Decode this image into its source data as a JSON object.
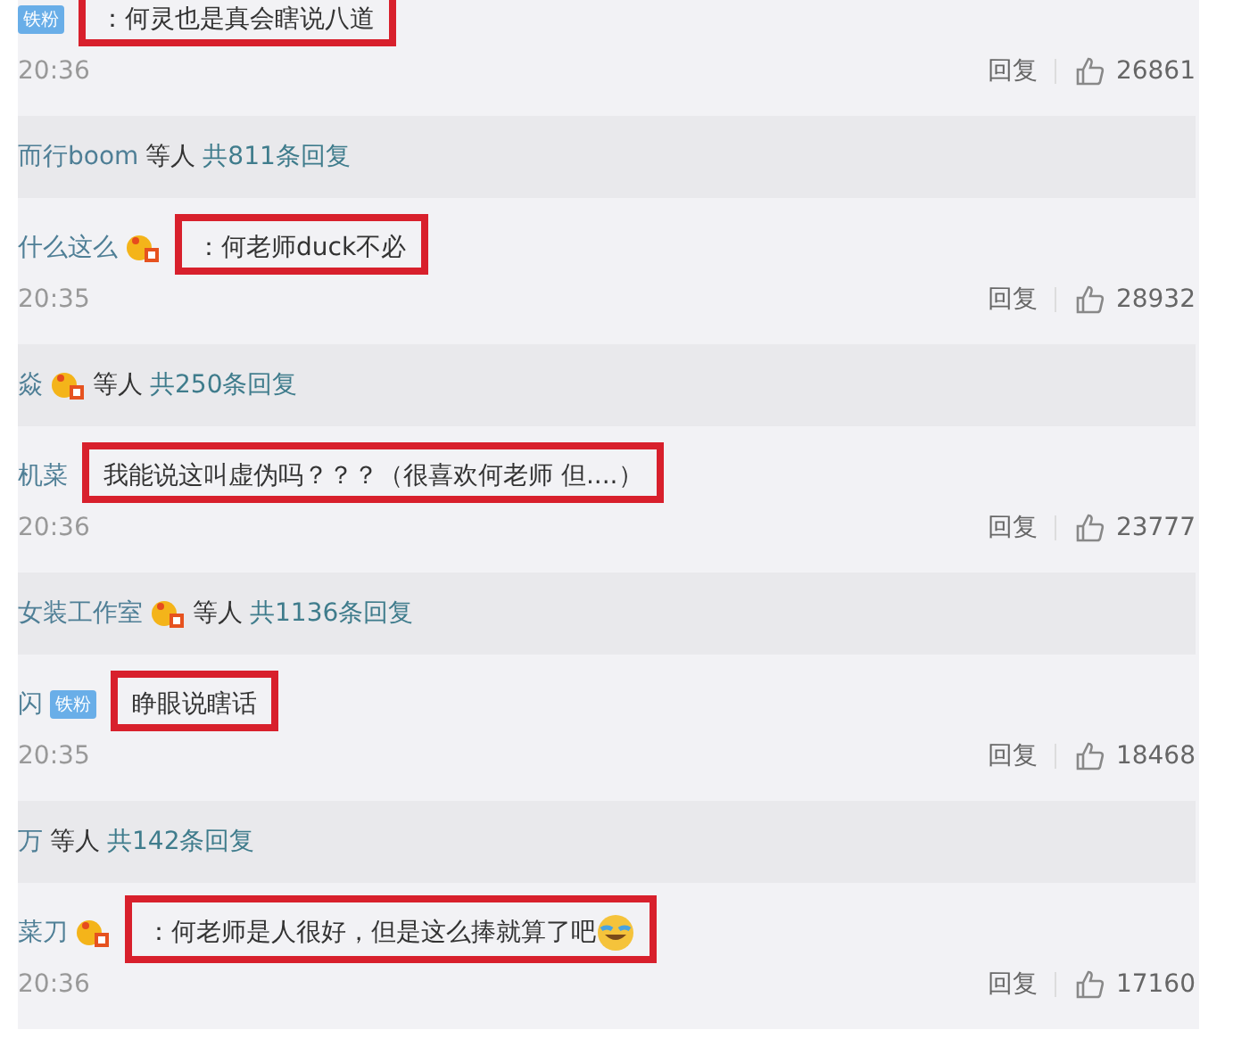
{
  "items": [
    {
      "kind": "comment",
      "badge": "铁粉",
      "vip": false,
      "text": "：何灵也是真会瞎说八道",
      "emoji": false,
      "highlighted": true,
      "time": "20:36",
      "reply": "回复",
      "likes": "26861"
    },
    {
      "kind": "summary",
      "names": "而行boom",
      "vip": false,
      "others": "等人",
      "count": "共811条回复"
    },
    {
      "kind": "comment",
      "name": "什么这么",
      "vip": true,
      "text": "：何老师duck不必",
      "emoji": false,
      "highlighted": true,
      "time": "20:35",
      "reply": "回复",
      "likes": "28932"
    },
    {
      "kind": "summary",
      "names": "焱",
      "vip": true,
      "others": "等人",
      "count": "共250条回复"
    },
    {
      "kind": "comment",
      "name": "机菜",
      "vip": false,
      "text": "我能说这叫虚伪吗？？？（很喜欢何老师 但....）",
      "emoji": false,
      "highlighted": true,
      "time": "20:36",
      "reply": "回复",
      "likes": "23777"
    },
    {
      "kind": "summary",
      "names": "女装工作室",
      "vip": true,
      "others": "等人",
      "count": "共1136条回复"
    },
    {
      "kind": "comment",
      "name": "闪",
      "badge": "铁粉",
      "vip": false,
      "text": "睁眼说瞎话",
      "emoji": false,
      "highlighted": true,
      "time": "20:35",
      "reply": "回复",
      "likes": "18468"
    },
    {
      "kind": "summary",
      "names": "万",
      "vip": false,
      "others": "等人",
      "count": "共142条回复"
    },
    {
      "kind": "comment",
      "name": "菜刀",
      "vip": true,
      "text": "：何老师是人很好，但是这么捧就算了吧",
      "emoji": true,
      "highlighted": true,
      "time": "20:36",
      "reply": "回复",
      "likes": "17160"
    }
  ]
}
